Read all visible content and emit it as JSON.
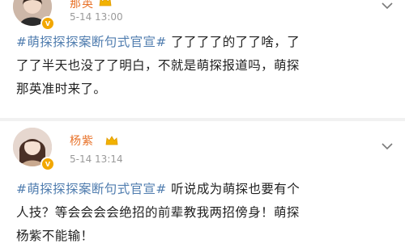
{
  "posts": [
    {
      "author": "那英",
      "timestamp": "5-14 13:00",
      "hashtag": "#萌探探探案断句式官宣#",
      "lines": [
        " 了了了了的了了啥，了",
        "了了半天也没了了明白，不就是萌探报道吗，萌探",
        "那英准时来了。"
      ]
    },
    {
      "author": "杨紫",
      "timestamp": "5-14 13:14",
      "hashtag": "#萌探探探案断句式官宣#",
      "lines": [
        " 听说成为萌探也要有个",
        "人技？等会会会会绝招的前辈教我两招傍身！萌探",
        "杨紫不能输！"
      ]
    }
  ],
  "icons": {
    "verified_badge": "verified-v-badge",
    "crown": "crown-icon",
    "chevron": "chevron-down-icon"
  },
  "colors": {
    "name": "#e8732b",
    "hashtag": "#507daf",
    "timestamp": "#9a9a9a",
    "badge": "#f2a700"
  }
}
